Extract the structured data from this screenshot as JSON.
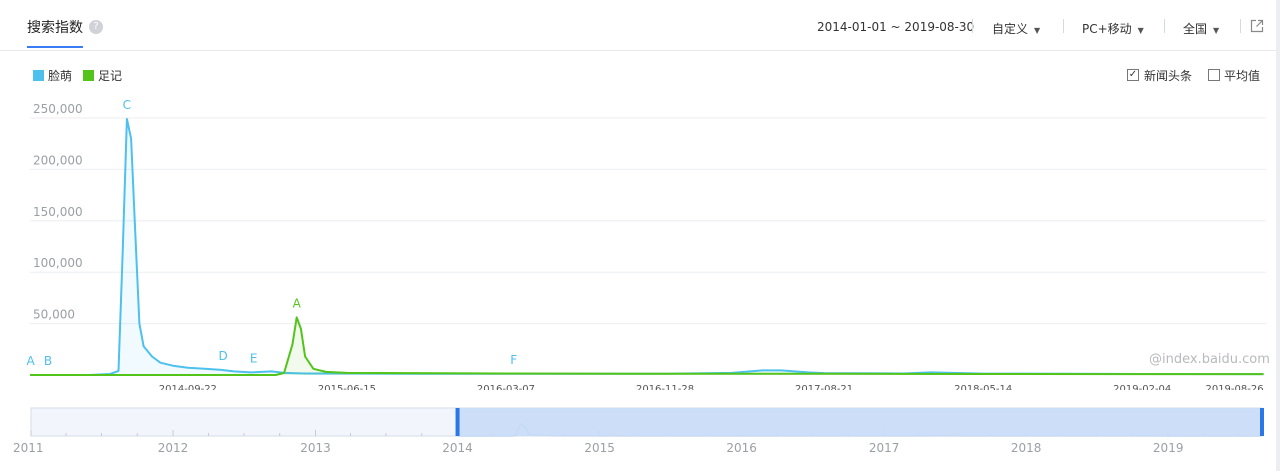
{
  "header": {
    "tab_label": "搜索指数",
    "help_icon": "?",
    "date_range": "2014-01-01 ~ 2019-08-30",
    "period_select": "自定义",
    "device_select": "PC+移动",
    "region_select": "全国",
    "export_icon": "external-link-icon"
  },
  "legend": [
    {
      "label": "脸萌",
      "color": "#4ec0ee"
    },
    {
      "label": "足记",
      "color": "#52c41a"
    }
  ],
  "options": {
    "news_label": "新闻头条",
    "news_checked": true,
    "average_label": "平均值",
    "average_checked": false
  },
  "watermark": "@index.baidu.com",
  "chart_data": {
    "type": "line",
    "yticks": [
      50000,
      100000,
      150000,
      200000,
      250000
    ],
    "ytick_labels": [
      "50,000",
      "100,000",
      "150,000",
      "200,000",
      "250,000"
    ],
    "ylim": [
      0,
      250000
    ],
    "xticks": [
      "2014-09-22",
      "2015-06-15",
      "2016-03-07",
      "2016-11-28",
      "2017-08-21",
      "2018-05-14",
      "2019-02-04",
      "2019-08-26"
    ],
    "x_range": [
      "2014-01-01",
      "2019-08-30"
    ],
    "grid": "horizontal",
    "series": [
      {
        "name": "脸萌",
        "color": "#4ec0ee",
        "points": [
          [
            "2014-01-01",
            0
          ],
          [
            "2014-04-10",
            0
          ],
          [
            "2014-05-15",
            1000
          ],
          [
            "2014-05-29",
            4000
          ],
          [
            "2014-06-05",
            120000
          ],
          [
            "2014-06-12",
            249000
          ],
          [
            "2014-06-19",
            230000
          ],
          [
            "2014-06-26",
            140000
          ],
          [
            "2014-07-03",
            50000
          ],
          [
            "2014-07-10",
            28000
          ],
          [
            "2014-07-24",
            18000
          ],
          [
            "2014-08-07",
            12000
          ],
          [
            "2014-08-28",
            9000
          ],
          [
            "2014-09-22",
            7000
          ],
          [
            "2014-10-20",
            6000
          ],
          [
            "2014-11-17",
            5000
          ],
          [
            "2014-12-08",
            3500
          ],
          [
            "2015-01-05",
            2500
          ],
          [
            "2015-02-09",
            3500
          ],
          [
            "2015-03-02",
            2000
          ],
          [
            "2015-04-06",
            1500
          ],
          [
            "2015-06-15",
            1500
          ],
          [
            "2015-10-01",
            1200
          ],
          [
            "2016-03-07",
            1200
          ],
          [
            "2016-11-28",
            1300
          ],
          [
            "2017-03-20",
            2000
          ],
          [
            "2017-05-10",
            4500
          ],
          [
            "2017-06-10",
            4500
          ],
          [
            "2017-07-25",
            2500
          ],
          [
            "2017-08-21",
            1800
          ],
          [
            "2018-01-01",
            1500
          ],
          [
            "2018-02-15",
            2500
          ],
          [
            "2018-05-14",
            1400
          ],
          [
            "2018-10-01",
            1200
          ],
          [
            "2019-02-04",
            1000
          ],
          [
            "2019-08-26",
            900
          ]
        ]
      },
      {
        "name": "足记",
        "color": "#52c41a",
        "points": [
          [
            "2014-01-01",
            0
          ],
          [
            "2015-02-16",
            0
          ],
          [
            "2015-03-02",
            2000
          ],
          [
            "2015-03-16",
            30000
          ],
          [
            "2015-03-23",
            56000
          ],
          [
            "2015-03-30",
            45000
          ],
          [
            "2015-04-06",
            18000
          ],
          [
            "2015-04-20",
            6000
          ],
          [
            "2015-05-11",
            3000
          ],
          [
            "2015-06-15",
            2000
          ],
          [
            "2016-03-07",
            1500
          ],
          [
            "2016-11-28",
            1200
          ],
          [
            "2017-08-21",
            1200
          ],
          [
            "2018-05-14",
            1000
          ],
          [
            "2019-02-04",
            900
          ],
          [
            "2019-08-26",
            900
          ]
        ]
      }
    ],
    "annotations": [
      {
        "label": "A",
        "series": 0,
        "date": "2014-01-02"
      },
      {
        "label": "B",
        "series": 0,
        "date": "2014-01-31"
      },
      {
        "label": "C",
        "series": 0,
        "date": "2014-06-12"
      },
      {
        "label": "D",
        "series": 0,
        "date": "2014-11-20"
      },
      {
        "label": "E",
        "series": 0,
        "date": "2015-01-10"
      },
      {
        "label": "A",
        "series": 1,
        "date": "2015-03-23"
      },
      {
        "label": "F",
        "series": 0,
        "date": "2016-03-20"
      }
    ],
    "navigator": {
      "years": [
        "2011",
        "2012",
        "2013",
        "2014",
        "2015",
        "2016",
        "2017",
        "2018",
        "2019"
      ],
      "full_range": [
        "2011-01-01",
        "2019-08-30"
      ],
      "selected_range": [
        "2014-01-01",
        "2019-08-30"
      ]
    }
  }
}
